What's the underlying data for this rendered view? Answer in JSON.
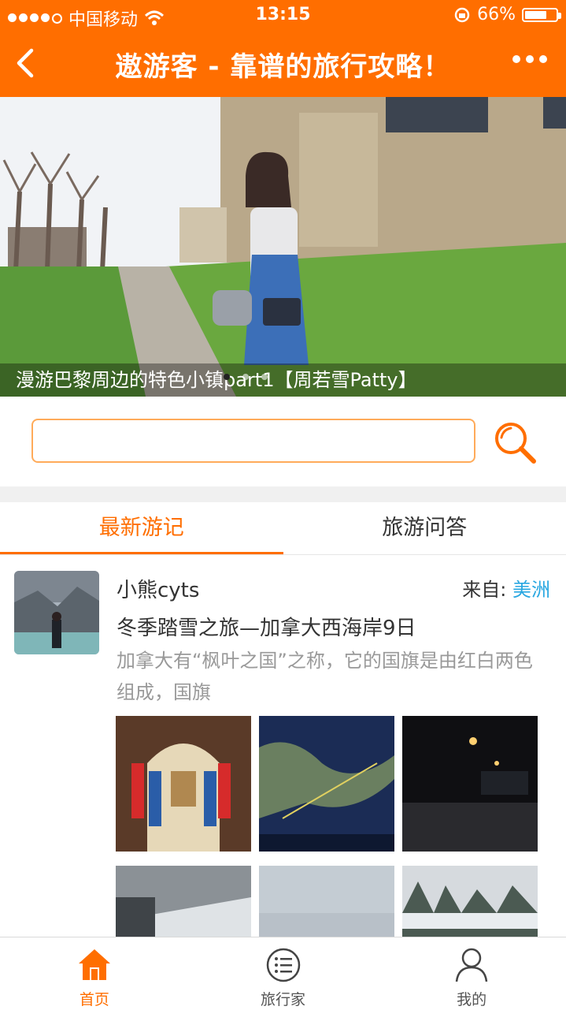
{
  "status_bar": {
    "carrier": "中国移动",
    "time": "13:15",
    "battery_percent": "66%",
    "battery_level": 0.66
  },
  "nav": {
    "title": "遨游客 - 靠谱的旅行攻略！"
  },
  "banner": {
    "caption": "漫游巴黎周边的特色小镇part1【周若雪Patty】",
    "page_count": 3,
    "active_page": 1
  },
  "search": {
    "value": "",
    "placeholder": ""
  },
  "tabs": [
    {
      "label": "最新游记",
      "active": true
    },
    {
      "label": "旅游问答",
      "active": false
    }
  ],
  "feed": {
    "author": "小熊cyts",
    "from_label": "来自:",
    "region": "美洲",
    "title": "冬季踏雪之旅—加拿大西海岸9日",
    "excerpt": "加拿大有“枫叶之国”之称，它的国旗是由红白两色组成，国旗"
  },
  "tabbar": [
    {
      "label": "首页",
      "icon": "home-icon",
      "active": true
    },
    {
      "label": "旅行家",
      "icon": "list-icon",
      "active": false
    },
    {
      "label": "我的",
      "icon": "user-icon",
      "active": false
    }
  ],
  "colors": {
    "accent": "#ff6e00",
    "link": "#29a7e1"
  }
}
